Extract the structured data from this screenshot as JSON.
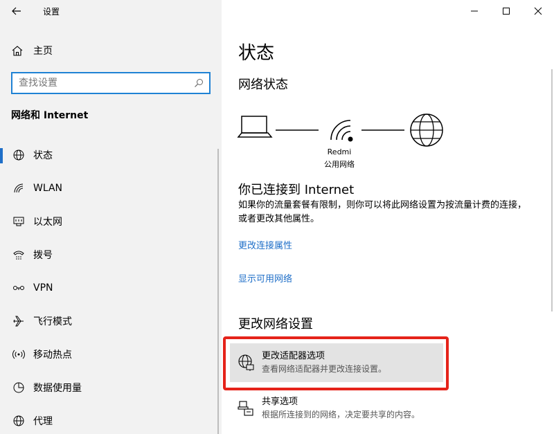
{
  "window": {
    "app_title": "设置"
  },
  "nav": {
    "home_label": "主页",
    "search_placeholder": "查找设置",
    "section_title": "网络和 Internet",
    "items": [
      {
        "label": "状态",
        "icon": "globe-icon",
        "active": true
      },
      {
        "label": "WLAN",
        "icon": "wifi-icon"
      },
      {
        "label": "以太网",
        "icon": "ethernet-icon"
      },
      {
        "label": "拨号",
        "icon": "dialup-icon"
      },
      {
        "label": "VPN",
        "icon": "vpn-icon"
      },
      {
        "label": "飞行模式",
        "icon": "airplane-icon"
      },
      {
        "label": "移动热点",
        "icon": "hotspot-icon"
      },
      {
        "label": "数据使用量",
        "icon": "data-usage-icon"
      },
      {
        "label": "代理",
        "icon": "globe-icon"
      }
    ]
  },
  "main": {
    "page_title": "状态",
    "network_status_heading": "网络状态",
    "network_name": "Redmi",
    "network_type": "公用网络",
    "connected_title": "你已连接到 Internet",
    "connected_desc": "如果你的流量套餐有限制，则你可以将此网络设置为按流量计费的连接，或者更改其他属性。",
    "link_change_properties": "更改连接属性",
    "link_show_networks": "显示可用网络",
    "change_settings_heading": "更改网络设置",
    "options": [
      {
        "title": "更改适配器选项",
        "subtitle": "查看网络适配器并更改连接设置。",
        "icon": "adapter-globe-icon",
        "highlighted": true
      },
      {
        "title": "共享选项",
        "subtitle": "根据所连接到的网络，决定要共享的内容。",
        "icon": "sharing-icon"
      }
    ]
  },
  "colors": {
    "accent": "#1f6fc8",
    "highlight_border": "#e5231a",
    "nav_bg": "#f2f2f2"
  }
}
